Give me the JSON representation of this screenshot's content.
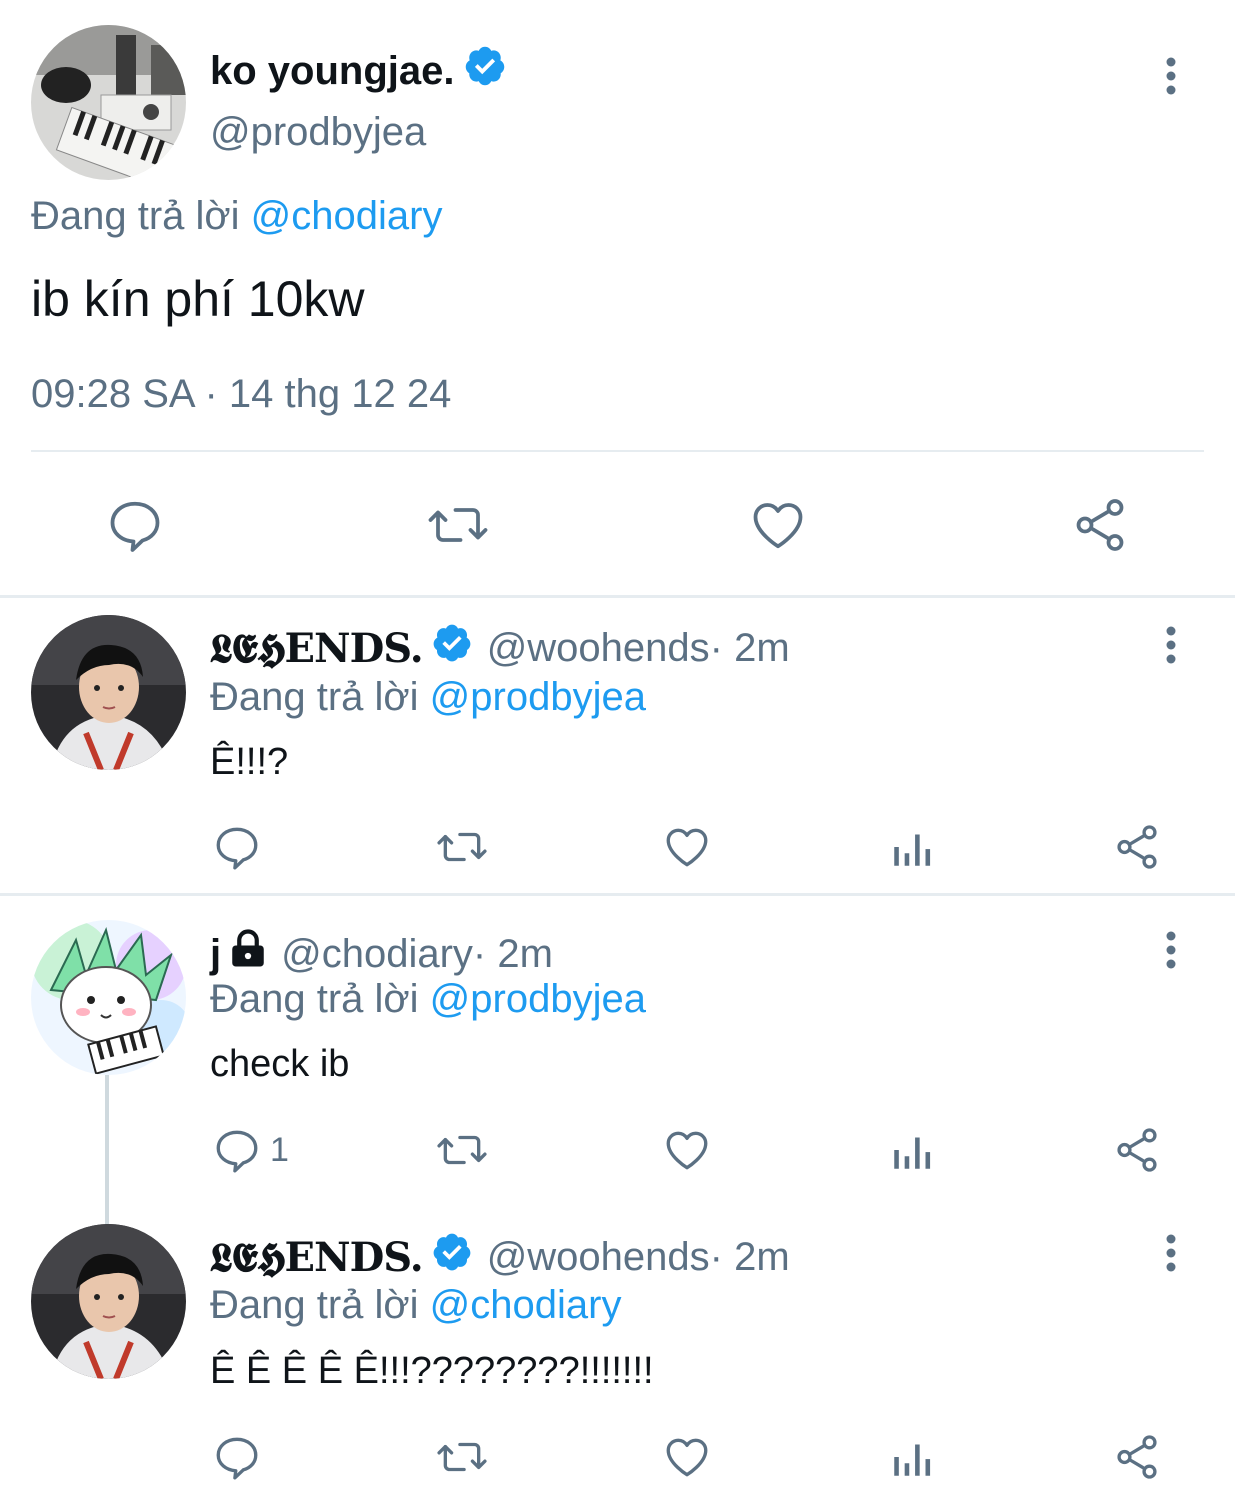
{
  "main_tweet": {
    "display_name": "ko youngjae.",
    "handle": "@prodbyjea",
    "replying_prefix": "Đang trả lời",
    "replying_to": "@chodiary",
    "text": "ib kín phí 10kw",
    "timestamp": "09:28 SA · 14 thg 12 24",
    "avatar_icon": "studio-desk-photo",
    "actions": [
      "reply-icon",
      "retweet-icon",
      "like-icon",
      "share-icon"
    ]
  },
  "replies": [
    {
      "display_name": "𝕷𝕰𝕳ENDS.",
      "verified": true,
      "handle": "@woohends",
      "sep_time": " · 2m",
      "replying_prefix": "Đang trả lời",
      "replying_to": "@prodbyjea",
      "text": "Ê!!!?",
      "reply_count": ""
    },
    {
      "display_name": "j",
      "verified": false,
      "protected": true,
      "handle": "@chodiary",
      "sep_time": " · 2m",
      "replying_prefix": "Đang trả lời",
      "replying_to": "@prodbyjea",
      "text": "check ib",
      "reply_count": "1"
    },
    {
      "display_name": "𝕷𝕰𝕳ENDS.",
      "verified": true,
      "handle": "@woohends",
      "sep_time": " · 2m",
      "replying_prefix": "Đang trả lời",
      "replying_to": "@chodiary",
      "text": "Ê Ê Ê Ê Ê!!!????????!!!!!!!",
      "reply_count": ""
    }
  ],
  "colors": {
    "link": "#1d9bf0",
    "muted": "#5b7083",
    "divider": "#e6ecf0",
    "verified": "#1d9bf0"
  }
}
